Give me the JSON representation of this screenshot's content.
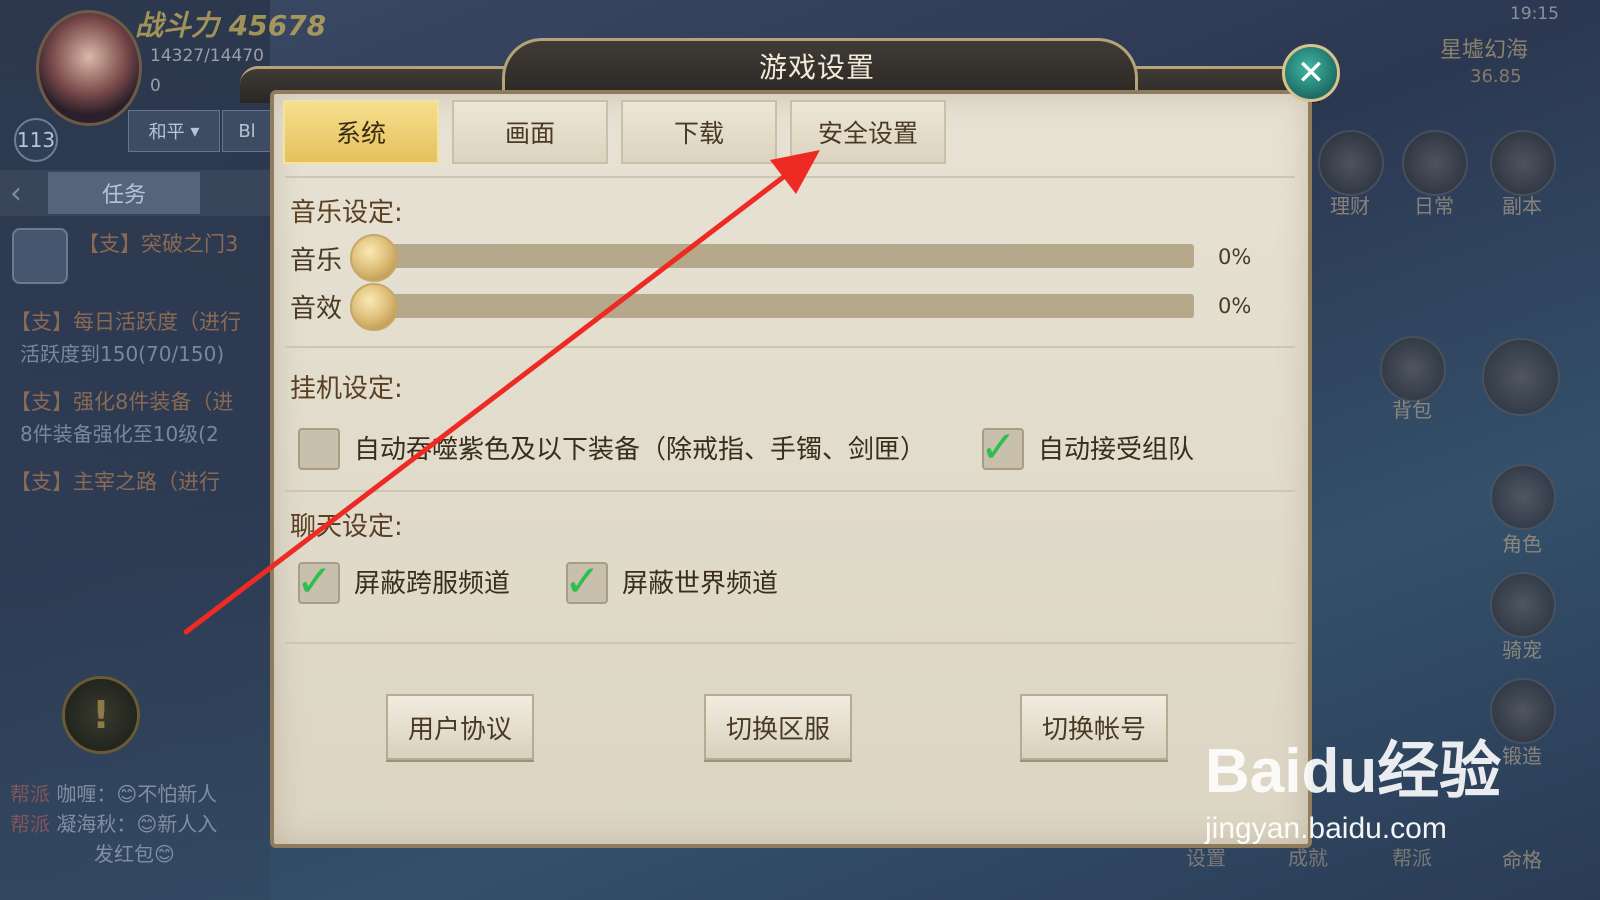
{
  "hud": {
    "power": "战斗力 45678",
    "hp": "14327/14470",
    "gold": "0",
    "level": "113",
    "mode": "和平",
    "mode2": "Bl",
    "time": "19:15",
    "server_name": "星墟幻海",
    "server_num": "36.85"
  },
  "tasks": {
    "tab": "任务",
    "items": [
      {
        "title": "【支】突破之门3",
        "sub": ""
      },
      {
        "title": "【支】每日活跃度（进行",
        "sub": "活跃度到150(70/150)"
      },
      {
        "title": "【支】强化8件装备（进",
        "sub": "8件装备强化至10级(2"
      },
      {
        "title": "【支】主宰之路（进行",
        "sub": ""
      }
    ]
  },
  "chat": [
    {
      "tag": "帮派",
      "text": "咖喱：😊不怕新人"
    },
    {
      "tag": "帮派",
      "text": "凝海秋：😊新人入"
    },
    {
      "tag": "",
      "text": "发红包😊"
    }
  ],
  "side_menu": [
    "理财",
    "日常",
    "副本",
    "背包",
    "角色",
    "骑宠",
    "锻造",
    "命格"
  ],
  "bottom_menu": [
    "设置",
    "成就",
    "帮派"
  ],
  "dialog": {
    "title": "游戏设置",
    "close_icon": "close-icon",
    "tabs": [
      {
        "label": "系统",
        "active": true
      },
      {
        "label": "画面",
        "active": false
      },
      {
        "label": "下载",
        "active": false
      },
      {
        "label": "安全设置",
        "active": false
      }
    ],
    "music_section": {
      "title": "音乐设定:",
      "sliders": [
        {
          "label": "音乐",
          "value": "0%"
        },
        {
          "label": "音效",
          "value": "0%"
        }
      ]
    },
    "idle_section": {
      "title": "挂机设定:",
      "options": [
        {
          "label": "自动吞噬紫色及以下装备（除戒指、手镯、剑匣）",
          "checked": false
        },
        {
          "label": "自动接受组队",
          "checked": true
        }
      ]
    },
    "chat_section": {
      "title": "聊天设定:",
      "options": [
        {
          "label": "屏蔽跨服频道",
          "checked": true
        },
        {
          "label": "屏蔽世界频道",
          "checked": true
        }
      ]
    },
    "buttons": [
      "用户协议",
      "切换区服",
      "切换帐号"
    ]
  },
  "colors": {
    "active_tab": "#e4c25c",
    "check_green": "#2fbf4f",
    "arrow_red": "#ee2a24"
  },
  "watermark": {
    "logo": "Baidu经验",
    "url": "jingyan.baidu.com"
  }
}
